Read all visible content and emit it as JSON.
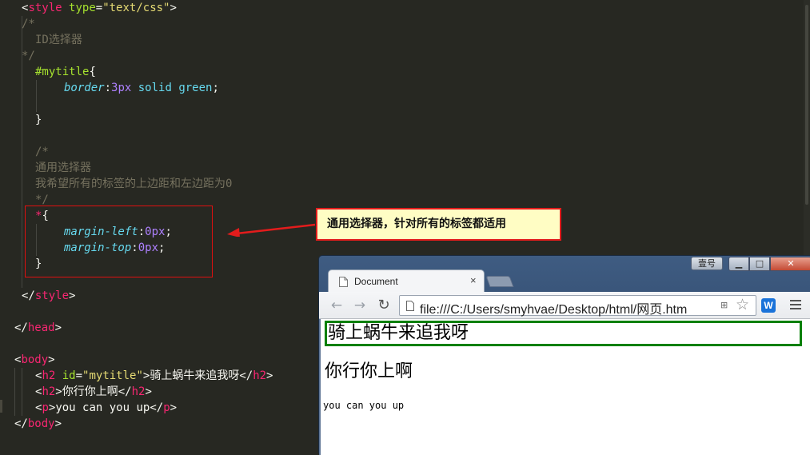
{
  "editor": {
    "lines": {
      "style_open_tag": "style",
      "style_type_attr": "type",
      "style_type_value": "\"text/css\"",
      "comment_open": "/*",
      "comment_id_selector": "ID选择器",
      "comment_close": "*/",
      "selector_mytitle": "#mytitle",
      "prop_border": "border",
      "border_num": "3px",
      "border_rest": "solid green",
      "comment2_open": "/*",
      "comment_universal": "通用选择器",
      "comment_wish": "我希望所有的标签的上边距和左边距为0",
      "comment2_close": "*/",
      "universal_selector": "*",
      "prop_margin_left": "margin-left",
      "margin_left_value": "0px",
      "prop_margin_top": "margin-top",
      "margin_top_value": "0px",
      "style_close_tag": "style",
      "head_close_tag": "head",
      "body_open_tag": "body",
      "h2_tag": "h2",
      "id_attr": "id",
      "id_value": "\"mytitle\"",
      "h2_first_text": "骑上蜗牛来追我呀",
      "h2_second_text": "你行你上啊",
      "p_tag": "p",
      "p_text": "you can you up",
      "body_close_tag": "body"
    }
  },
  "annotation": {
    "callout_text": "通用选择器，针对所有的标签都适用",
    "arrow_color": "#e31c1c"
  },
  "browser": {
    "tab_title": "Document",
    "tab_close": "×",
    "sys_button_label": "壹号",
    "url": "file:///C:/Users/smyhvae/Desktop/html/网页.htm",
    "extension_label": "W",
    "page": {
      "h2_first": "骑上蜗牛来追我呀",
      "h2_second": "你行你上啊",
      "paragraph": "you can you up"
    }
  }
}
